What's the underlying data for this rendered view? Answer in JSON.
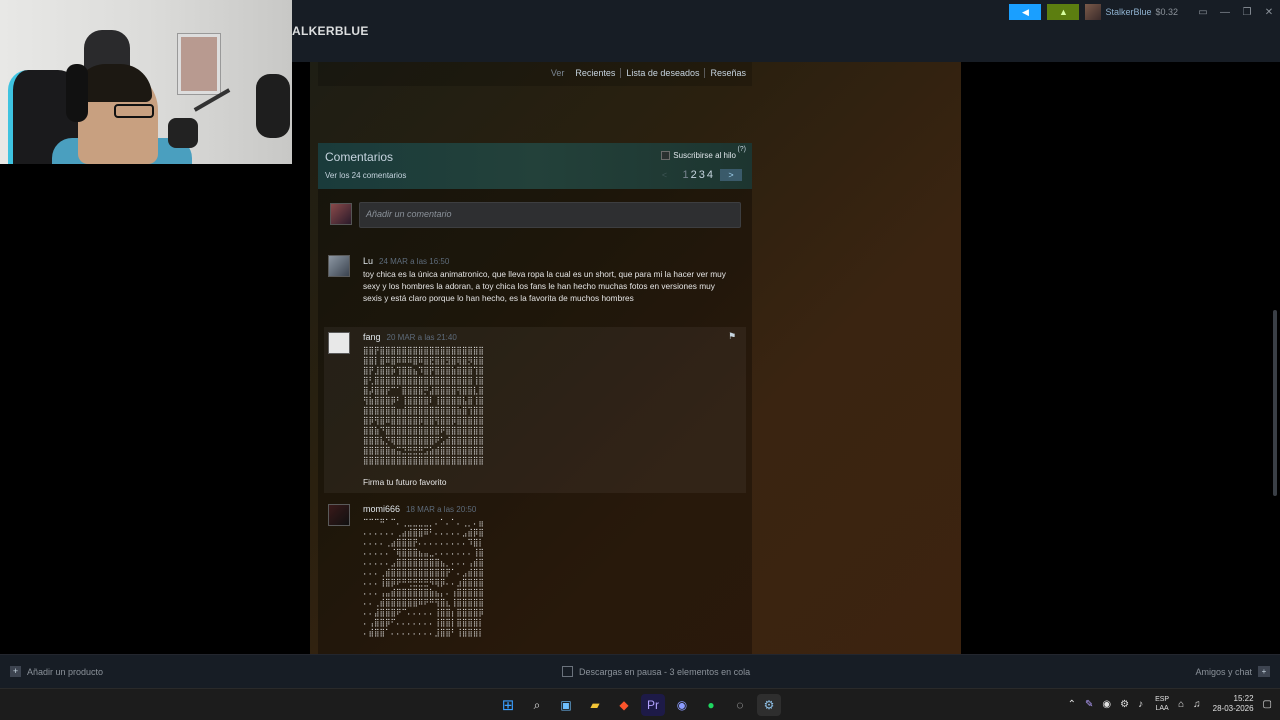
{
  "steam_header": {
    "title_fragment": "ALKERBLUE",
    "user_name": "StalkerBlue",
    "balance": "$0.32"
  },
  "profile_links": {
    "prefix": "Ver",
    "items": [
      "Recientes",
      "Lista de deseados",
      "Reseñas"
    ]
  },
  "comments_panel": {
    "title": "Comentarios",
    "view_all": "Ver los 24 comentarios",
    "subscribe_label": "Suscribirse al hilo",
    "help_mark": "(?)",
    "pages": [
      "1",
      "2",
      "3",
      "4"
    ],
    "next_label": ">",
    "prev_label": "<",
    "add_placeholder": "Añadir un comentario"
  },
  "comments": [
    {
      "author": "Lu",
      "time": "24 MAR a las 16:50",
      "text": "toy chica es la única animatronico, que lleva ropa la cual es un short, que para mi la hacer ver muy sexy y los hombres la adoran, a toy chica los fans le han hecho muchas fotos en versiones muy sexis y está claro porque lo han hecho, es la favorita de muchos hombres"
    },
    {
      "author": "fang",
      "time": "20 MAR a las 21:40",
      "ascii": "⣿⣿⡟⣿⣿⣿⣿⣿⣿⣿⣿⣿⣿⣿⣿⣿⣿⣿⣿⣿⣿⣿\n⣿⣿⡇⣿⠿⣿⠿⠿⠿⣿⠿⣿⣟⣿⣿⣻⣿⢿⣿⡻⣿⣿\n⣿⡟⣸⣿⣿⡷⢹⣿⣿⣦⠹⣿⡟⣿⣿⣿⣷⣿⣿⣿⢹⣿\n⣿⢃⣿⣿⣿⣿⣿⣿⣿⣿⣿⣿⣿⣿⣿⣿⣿⣿⣿⣿⢸⣿\n⣿⡼⣿⣿⡟⠉⠁⣿⣿⣿⣿⡛⣼⣿⣿⣿⣿⢻⣿⣿⣇⣿\n⢻⣷⣿⣿⣿⡿⠃⢸⣿⣿⣿⣿⠇⢸⣿⣿⣿⣿⣧⣿⢸⣿\n⣿⣿⣿⣿⣿⣿⣶⣾⣿⣿⣿⣿⣿⣿⣿⣿⣿⣷⣿⢹⣿⣿\n⣿⡿⢻⣿⠿⣿⣿⣿⣿⣿⡿⣿⣿⢻⣿⣿⡿⣿⣿⣿⣿⣿\n⣿⣿⣷⠙⣿⣿⣿⣿⣿⣿⣿⣿⣿⣿⠟⣿⣿⣿⣿⣿⣿⣿\n⣿⣿⣿⣧⡙⢿⣿⣿⣿⣿⣿⣿⣿⠟⣡⣾⣿⣿⣿⣿⣿⣿\n⣿⣿⣿⣿⣿⣶⣭⣙⣛⣛⣛⣩⣵⣾⣿⣿⣿⣿⣿⣿⣿⣿\n⣿⣿⣿⣿⣿⣿⣿⣿⣿⣿⣿⣿⣿⣿⣿⣿⣿⣿⣿⣿⣿⣿",
      "signature": "Firma tu futuro favorito"
    },
    {
      "author": "momi666",
      "time": "18 MAR a las 20:50",
      "ascii": "⠉⠉⠉⠛⠁⠉⠄⢀⣀⣀⣀⣀⡀⠄⠁⠄⠁⠄⢀⡀⠄⣶\n⠄⠄⠄⠄⠄⠄⢀⣴⣾⣿⣿⠿⠃⠄⠄⠄⠄⠄⣠⣾⡿⣿\n⠄⠄⠄⠄⢀⣴⣿⣿⣿⡟⠄⠄⠄⠄⠄⠄⠄⠄⠄⠹⣿⡇\n⠄⠄⠄⠄⠄⠈⢿⣿⣿⣿⣦⣤⣀⠄⠄⠄⠄⠄⠄⠄⢸⣿\n⠄⠄⠄⠄⠄⣠⣿⣿⣿⣿⣿⣿⣿⣿⣦⡀⠄⠄⠄⢠⣾⣿\n⠄⠄⠄⢀⣾⣿⣿⣿⣿⣿⣿⣿⣿⣿⣿⡟⠁⠄⣠⣾⣿⣿\n⠄⠄⠄⢸⣿⡿⠟⠛⢛⣛⣛⣛⠻⢿⡿⠄⠄⣰⣿⣿⣿⣿\n⠄⠄⠄⢠⣤⣾⣿⣿⣿⣿⣿⣿⣷⣦⡄⠄⢰⣿⣿⣿⣿⣿\n⠄⠄⢀⣾⣿⣿⣿⣿⣿⣿⠿⠟⠛⢻⣿⣆⢸⣿⣿⣿⣿⣿\n⠄⠄⣼⣿⣿⣿⠟⠉⠄⠄⠄⠄⠄⢸⣿⣿⡆⣿⣿⣿⣿⡿\n⠄⢠⣿⣿⡿⠋⠄⠄⠄⠄⠄⠄⠄⢸⣿⣿⡇⣿⣿⣿⣿⡇\n⠄⣾⣿⣿⠁⠄⠄⠄⠄⠄⠄⠄⠄⣸⣿⣿⠃⢸⣿⣿⣿⡇"
    }
  ],
  "bottom_bar": {
    "add_product": "Añadir un producto",
    "downloads": "Descargas en pausa - 3 elementos en cola",
    "friends": "Amigos y chat"
  },
  "taskbar": {
    "lang_line1": "ESP",
    "lang_line2": "LAA",
    "time": "15:22",
    "date": "28-03-2026"
  },
  "colors": {
    "steam_dark": "#171d25",
    "accent_blue": "#1a9fff",
    "notif_green": "#5c7e10",
    "comment_header": "#1a3b3b"
  }
}
